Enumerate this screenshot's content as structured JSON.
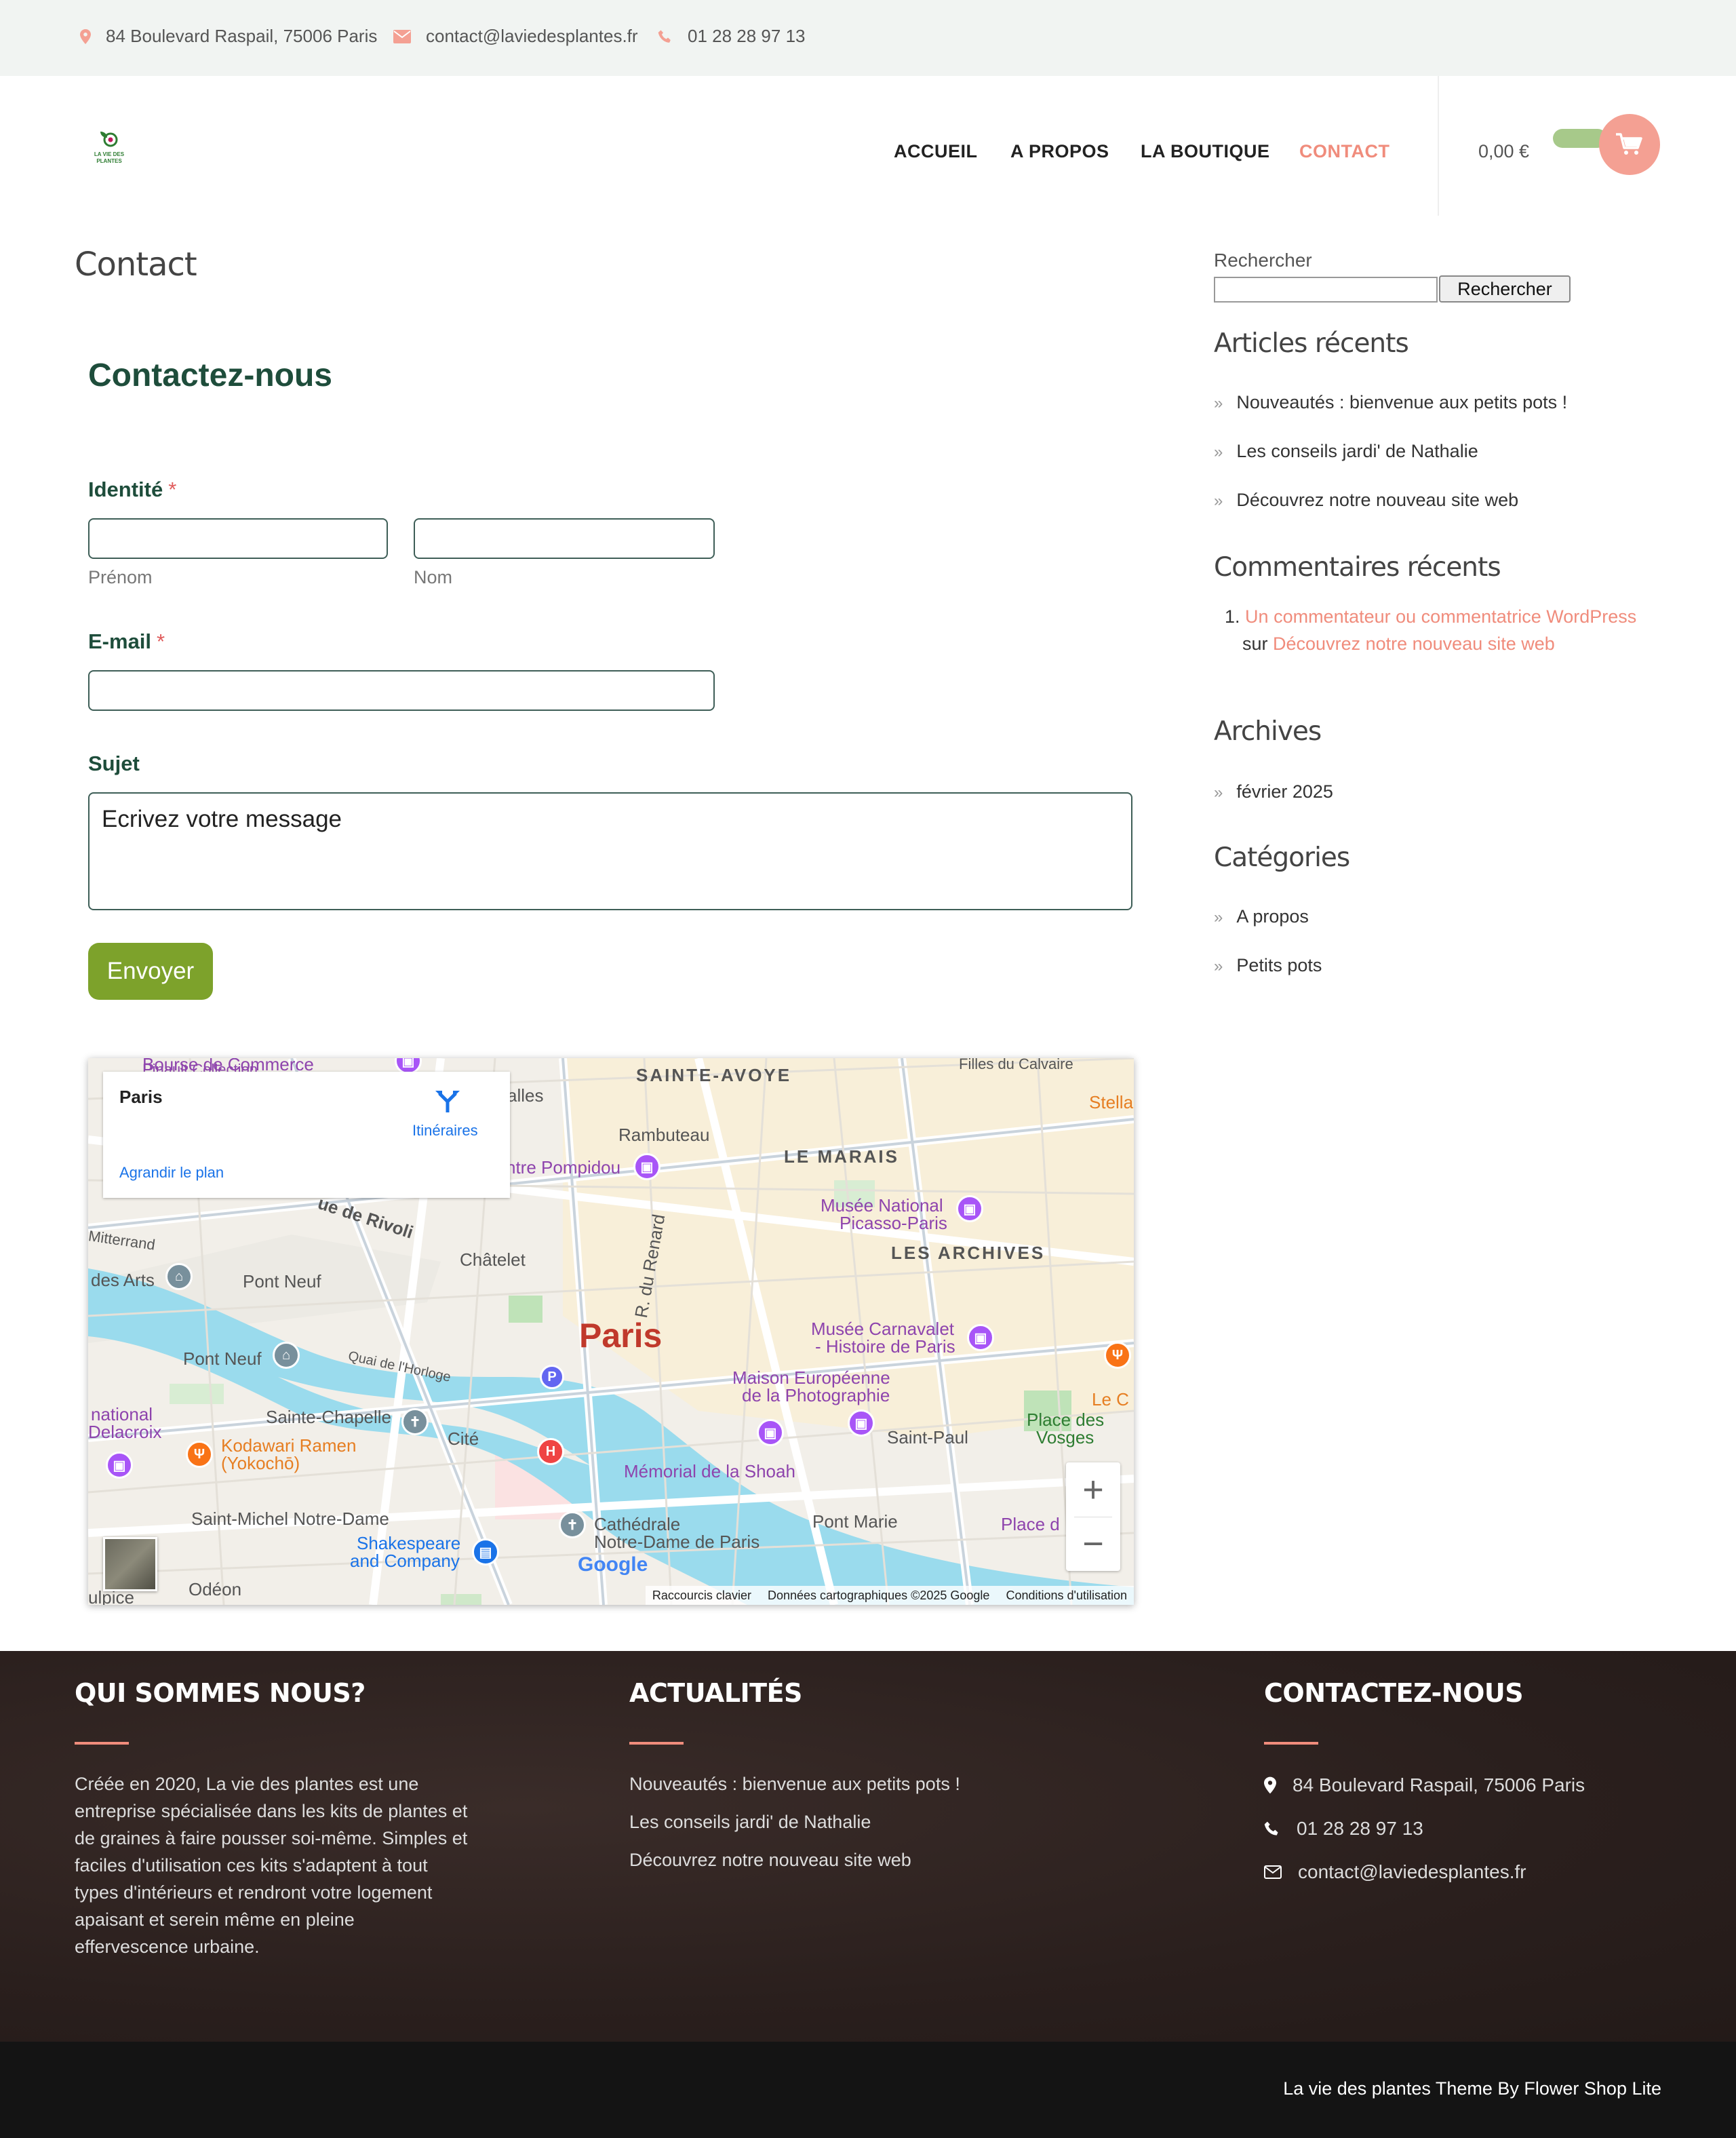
{
  "topbar": {
    "address": "84 Boulevard Raspail, 75006 Paris",
    "email": "contact@laviedesplantes.fr",
    "phone": "01 28 28 97 13"
  },
  "header": {
    "logo_text": "LA VIE DES PLANTES",
    "nav": [
      "ACCUEIL",
      "A PROPOS",
      "LA BOUTIQUE",
      "CONTACT"
    ],
    "active_nav": "CONTACT",
    "cart_total": "0,00 €"
  },
  "main": {
    "page_title": "Contact",
    "form_title": "Contactez-nous",
    "identity_label": "Identité",
    "required_mark": "*",
    "firstname_sub": "Prénom",
    "lastname_sub": "Nom",
    "email_label": "E-mail",
    "subject_label": "Sujet",
    "message_placeholder": "Ecrivez votre message",
    "send_label": "Envoyer"
  },
  "map": {
    "card_title": "Paris",
    "directions_label": "Itinéraires",
    "enlarge_label": "Agrandir le plan",
    "city_label": "Paris",
    "labels": {
      "sainte_avoye": "SAINTE-AVOYE",
      "le_marais": "LE MARAIS",
      "les_archives": "LES ARCHIVES",
      "rambuteau": "Rambuteau",
      "pompidou": "ntre Pompidou",
      "halles": "alles",
      "rivoli": "ue de Rivoli",
      "chatelet": "Châtelet",
      "pont_neuf_metro": "Pont Neuf",
      "pont_neuf": "Pont Neuf",
      "des_arts": "des Arts",
      "mitterrand": "Mitterrand",
      "renard": "R. du Renard",
      "musee_national_1": "Musée National",
      "musee_national_2": "Picasso-Paris",
      "carnavalet_1": "Musée Carnavalet",
      "carnavalet_2": "- Histoire de Paris",
      "mep_1": "Maison Européenne",
      "mep_2": "de la Photographie",
      "quai_horloge": "Quai de l'Horloge",
      "sainte_chapelle": "Sainte-Chapelle",
      "cite": "Cité",
      "kodawari_1": "Kodawari Ramen",
      "kodawari_2": "(Yokochō)",
      "delacroix_1": "national",
      "delacroix_2": "Delacroix",
      "st_michel": "Saint-Michel Notre-Dame",
      "shakespeare_1": "Shakespeare",
      "shakespeare_2": "and Company",
      "notre_dame_1": "Cathédrale",
      "notre_dame_2": "Notre-Dame de Paris",
      "memorial": "Mémorial de la Shoah",
      "saint_paul": "Saint-Paul",
      "pont_marie": "Pont Marie",
      "vosges_1": "Place des",
      "vosges_2": "Vosges",
      "place_d": "Place d",
      "stella": "Stella",
      "le_c": "Le C",
      "filles": "Filles du Calvaire",
      "odeon": "Odéon",
      "sulpice": "ulpice",
      "commerce": "Bourse de Commerce",
      "pinault": "Pinault Collection"
    },
    "google": "Google",
    "footer_links": [
      "Raccourcis clavier",
      "Données cartographiques ©2025 Google",
      "Conditions d'utilisation"
    ]
  },
  "sidebar": {
    "search_label": "Rechercher",
    "search_button": "Rechercher",
    "recent_posts_title": "Articles récents",
    "recent_posts": [
      "Nouveautés : bienvenue aux petits pots !",
      "Les conseils jardi' de Nathalie",
      "Découvrez notre nouveau site web"
    ],
    "recent_comments_title": "Commentaires récents",
    "comment_number": "1.",
    "comment_author": "Un commentateur ou commentatrice WordPress",
    "comment_on": "sur",
    "comment_post": "Découvrez notre nouveau site web",
    "archives_title": "Archives",
    "archives": [
      "février 2025"
    ],
    "categories_title": "Catégories",
    "categories": [
      "A propos",
      "Petits pots"
    ]
  },
  "footer": {
    "about_title": "QUI SOMMES NOUS?",
    "about_text": "Créée en 2020, La vie des plantes est une entreprise spécialisée dans les kits de plantes et de graines à faire pousser soi-même. Simples et faciles d'utilisation ces kits s'adaptent à tout types d'intérieurs et rendront votre logement apaisant et serein même en pleine effervescence urbaine.",
    "news_title": "ACTUALITÉS",
    "news": [
      "Nouveautés : bienvenue aux petits pots !",
      "Les conseils jardi' de Nathalie",
      "Découvrez notre nouveau site web"
    ],
    "contact_title": "CONTACTEZ-NOUS",
    "contact_address": "84 Boulevard Raspail, 75006 Paris",
    "contact_phone": "01 28 28 97 13",
    "contact_email": "contact@laviedesplantes.fr",
    "copyright": "La vie des plantes Theme By Flower Shop Lite"
  },
  "colors": {
    "accent": "#f08c7c",
    "dark_green": "#1e4d3b",
    "button_green": "#7da22b",
    "footer_bg": "#2a1f1d"
  }
}
